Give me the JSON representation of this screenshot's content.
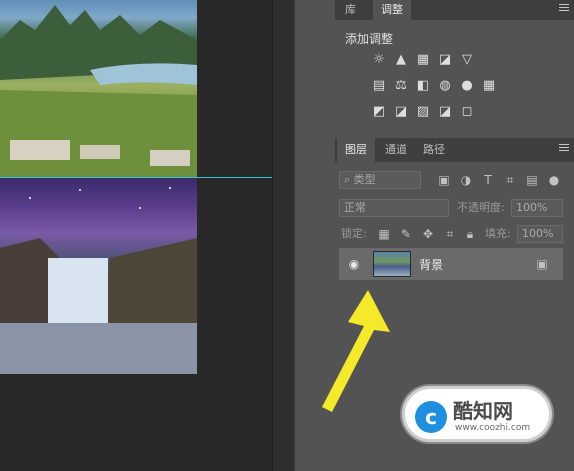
{
  "library_tabs": {
    "tab1": "库",
    "tab2": "调整"
  },
  "adjustments": {
    "title": "添加调整",
    "row1": [
      "☼",
      "▲",
      "▦",
      "◪",
      "▽"
    ],
    "row2": [
      "▤",
      "⚖",
      "◧",
      "◍",
      "●",
      "▦"
    ],
    "row3": [
      "◩",
      "◪",
      "▨",
      "◪",
      "◻"
    ]
  },
  "layers_tabs": {
    "tab1": "图层",
    "tab2": "通道",
    "tab3": "路径"
  },
  "filter": {
    "kind_label": "类型"
  },
  "blend": {
    "mode": "正常",
    "opacity_label": "不透明度:",
    "opacity_value": "100%"
  },
  "lock": {
    "label": "锁定:",
    "fill_label": "填充:",
    "fill_value": "100%"
  },
  "layer": {
    "name": "背景"
  },
  "watermark": {
    "logo": "c",
    "name": "酷知网",
    "url": "www.coozhi.com"
  },
  "colors": {
    "panel": "#535353",
    "guide": "#39c4d6",
    "arrow": "#f5ea2a"
  }
}
